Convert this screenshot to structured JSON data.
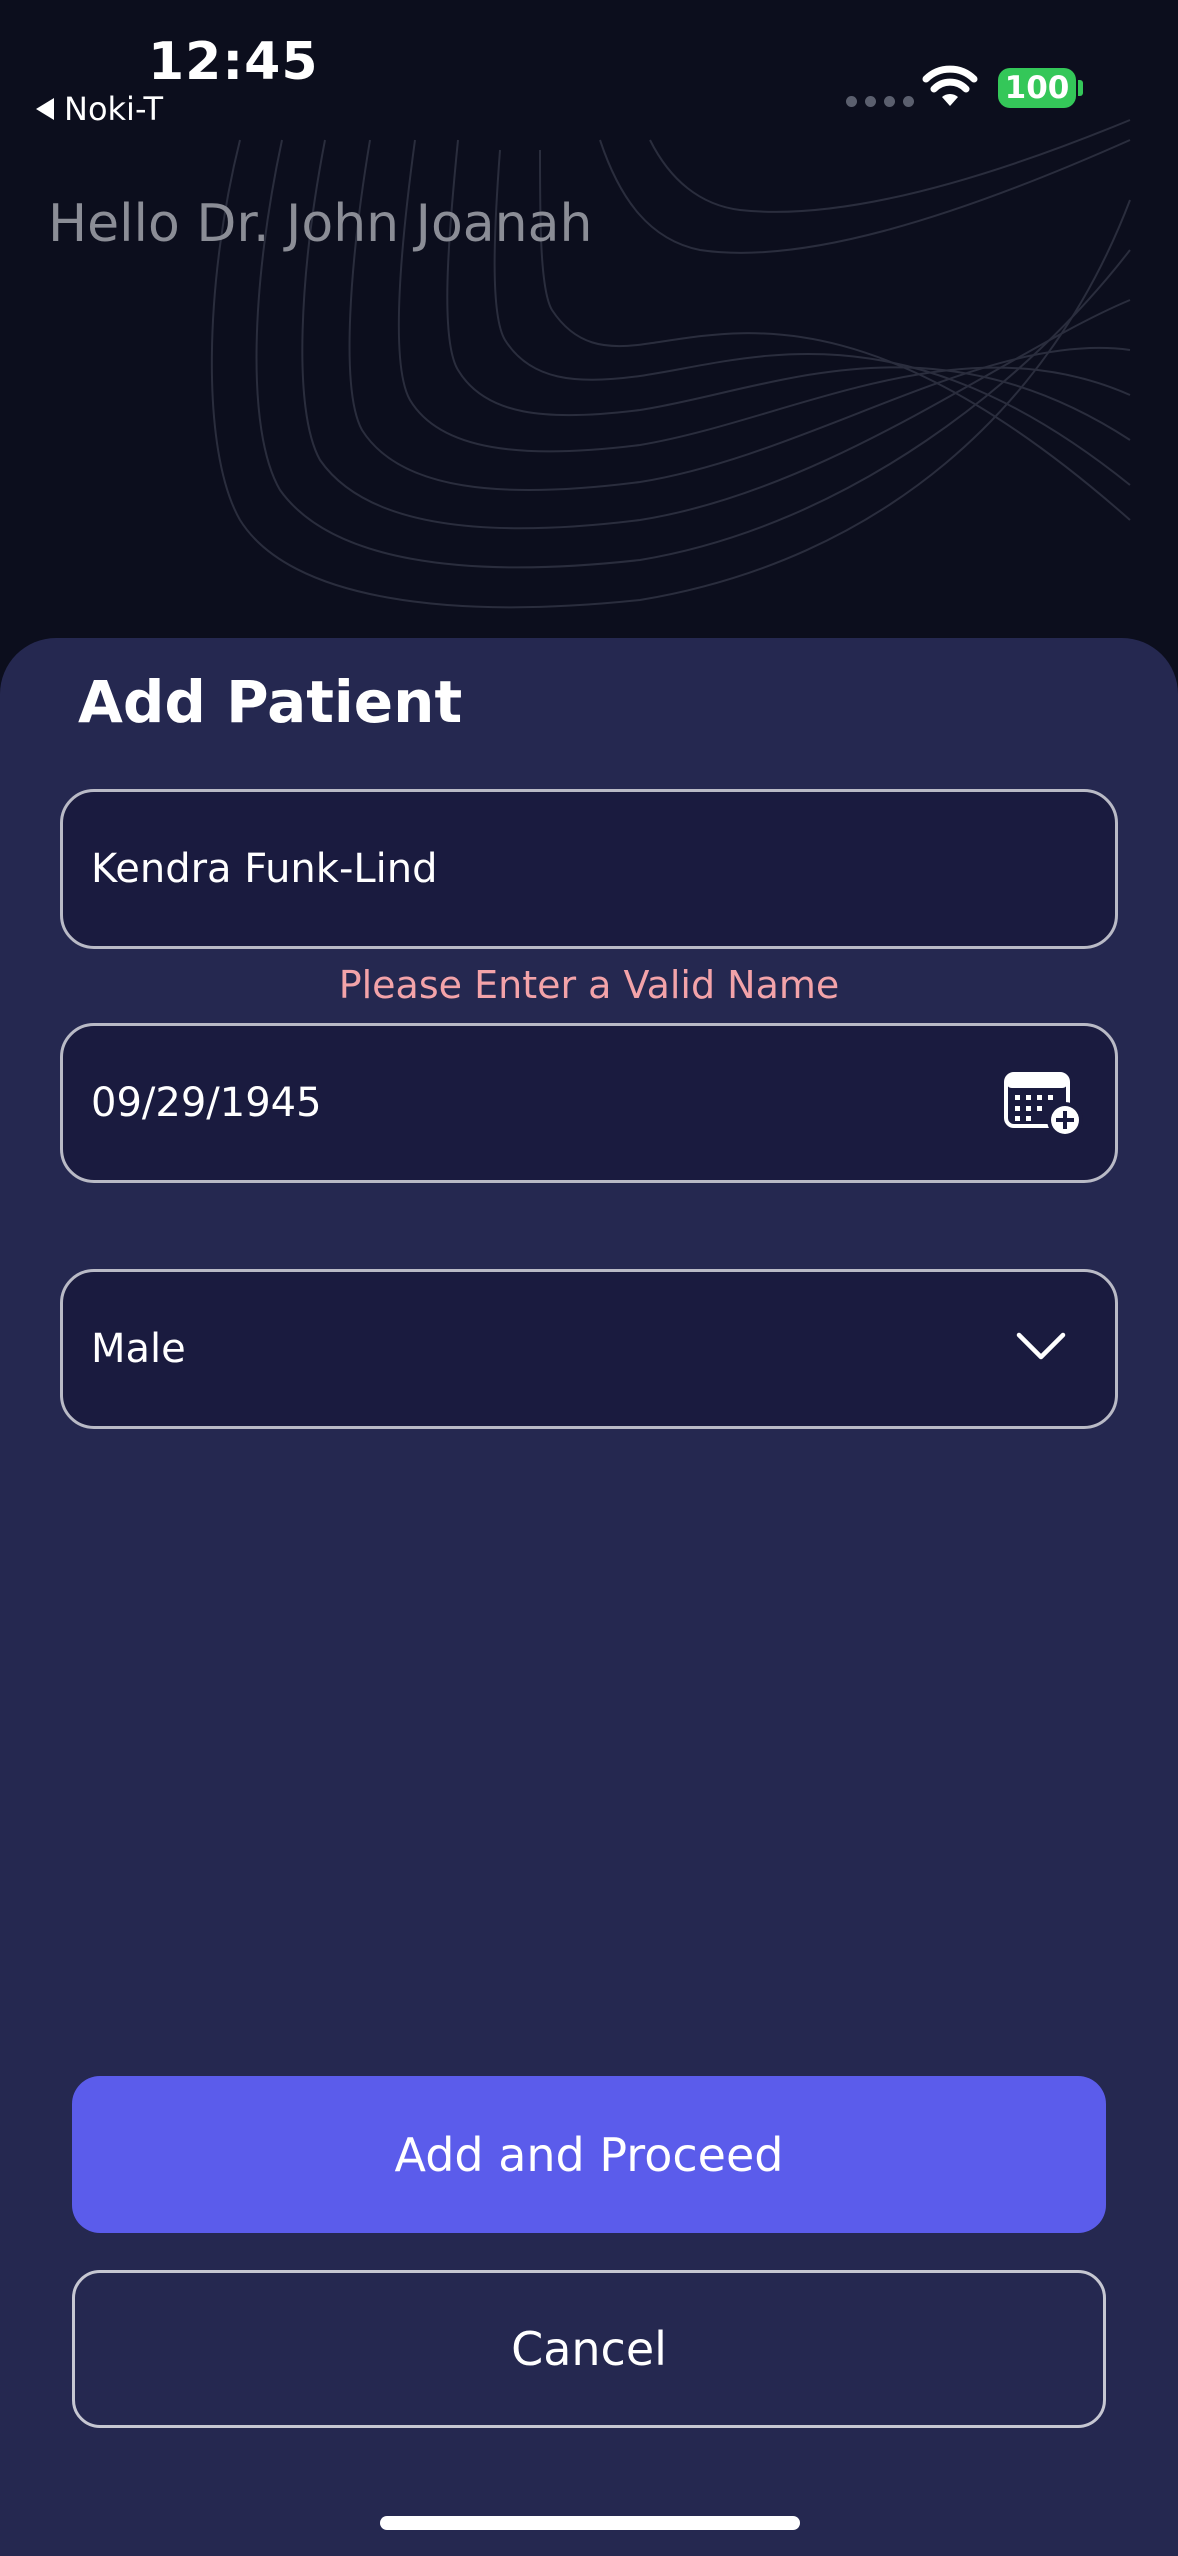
{
  "status_bar": {
    "time": "12:45",
    "back_app": "Noki-T",
    "battery": "100",
    "battery_color": "#34c759"
  },
  "header": {
    "greeting": "Hello Dr. John Joanah"
  },
  "sheet": {
    "title": "Add Patient",
    "name_field": {
      "value": "Kendra Funk-Lind"
    },
    "name_error": "Please Enter a Valid Name",
    "dob_field": {
      "value": "09/29/1945",
      "icon": "calendar-add-icon"
    },
    "gender_field": {
      "value": "Male",
      "icon": "chevron-down-icon"
    },
    "primary_button": "Add and Proceed",
    "secondary_button": "Cancel"
  },
  "colors": {
    "background": "#0c0e1d",
    "sheet": "#252850",
    "field": "#1a1b3f",
    "accent": "#5b5ceb",
    "error": "#f3a3a9"
  }
}
